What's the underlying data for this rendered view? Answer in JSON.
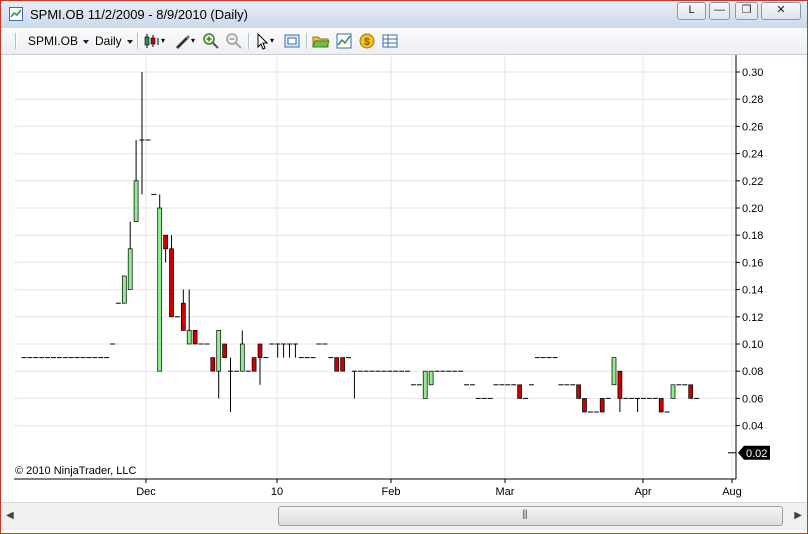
{
  "window": {
    "title": "SPMI.OB  11/2/2009 - 8/9/2010 (Daily)",
    "buttons": {
      "l": "L",
      "minimize": "—",
      "restore": "❐",
      "close": "✕"
    }
  },
  "toolbar": {
    "instrument": "SPMI.OB",
    "interval": "Daily",
    "icons": [
      "candlestick-style-icon",
      "drawing-tool-icon",
      "zoom-in-icon",
      "zoom-out-icon",
      "pointer-icon",
      "snapshot-icon",
      "open-folder-icon",
      "chart-properties-icon",
      "money-icon",
      "data-box-icon"
    ]
  },
  "copyright": "© 2010 NinjaTrader, LLC",
  "colors": {
    "up": "#90ee90",
    "down": "#cc0000",
    "wick": "#000000",
    "grid": "#e6e6e6"
  },
  "chart_data": {
    "type": "candlestick",
    "x_labels": [
      "Dec",
      "10",
      "Feb",
      "Mar",
      "Apr",
      "Aug"
    ],
    "y_ticks": [
      "0.30",
      "0.28",
      "0.26",
      "0.24",
      "0.22",
      "0.20",
      "0.18",
      "0.16",
      "0.14",
      "0.12",
      "0.10",
      "0.08",
      "0.06",
      "0.04"
    ],
    "ylim": [
      0.02,
      0.3
    ],
    "last_price": "0.02",
    "grid": true,
    "candles": [
      {
        "o": 0.09,
        "h": 0.09,
        "l": 0.09,
        "c": 0.09,
        "n": 15
      },
      {
        "o": 0.1,
        "h": 0.1,
        "l": 0.1,
        "c": 0.1
      },
      {
        "o": 0.13,
        "h": 0.13,
        "l": 0.13,
        "c": 0.13
      },
      {
        "o": 0.13,
        "h": 0.15,
        "l": 0.13,
        "c": 0.15
      },
      {
        "o": 0.14,
        "h": 0.19,
        "l": 0.14,
        "c": 0.17
      },
      {
        "o": 0.19,
        "h": 0.25,
        "l": 0.19,
        "c": 0.22
      },
      {
        "o": 0.25,
        "h": 0.3,
        "l": 0.21,
        "c": 0.25
      },
      {
        "o": 0.25,
        "h": 0.25,
        "l": 0.25,
        "c": 0.25
      },
      {
        "o": 0.21,
        "h": 0.21,
        "l": 0.21,
        "c": 0.21
      },
      {
        "o": 0.08,
        "h": 0.21,
        "l": 0.08,
        "c": 0.2
      },
      {
        "o": 0.18,
        "h": 0.18,
        "l": 0.16,
        "c": 0.17
      },
      {
        "o": 0.17,
        "h": 0.18,
        "l": 0.12,
        "c": 0.12
      },
      {
        "o": 0.12,
        "h": 0.12,
        "l": 0.12,
        "c": 0.12
      },
      {
        "o": 0.13,
        "h": 0.14,
        "l": 0.11,
        "c": 0.11
      },
      {
        "o": 0.1,
        "h": 0.14,
        "l": 0.1,
        "c": 0.11
      },
      {
        "o": 0.11,
        "h": 0.11,
        "l": 0.1,
        "c": 0.1
      },
      {
        "o": 0.1,
        "h": 0.1,
        "l": 0.1,
        "c": 0.1
      },
      {
        "o": 0.1,
        "h": 0.1,
        "l": 0.1,
        "c": 0.1
      },
      {
        "o": 0.09,
        "h": 0.09,
        "l": 0.08,
        "c": 0.08
      },
      {
        "o": 0.08,
        "h": 0.11,
        "l": 0.06,
        "c": 0.11
      },
      {
        "o": 0.1,
        "h": 0.1,
        "l": 0.09,
        "c": 0.09
      },
      {
        "o": 0.08,
        "h": 0.09,
        "l": 0.05,
        "c": 0.08
      },
      {
        "o": 0.08,
        "h": 0.08,
        "l": 0.08,
        "c": 0.08
      },
      {
        "o": 0.08,
        "h": 0.11,
        "l": 0.08,
        "c": 0.1
      },
      {
        "o": 0.08,
        "h": 0.08,
        "l": 0.08,
        "c": 0.08
      },
      {
        "o": 0.09,
        "h": 0.09,
        "l": 0.08,
        "c": 0.08
      },
      {
        "o": 0.1,
        "h": 0.1,
        "l": 0.07,
        "c": 0.09
      },
      {
        "o": 0.09,
        "h": 0.09,
        "l": 0.09,
        "c": 0.09
      },
      {
        "o": 0.1,
        "h": 0.1,
        "l": 0.1,
        "c": 0.1
      },
      {
        "o": 0.1,
        "h": 0.1,
        "l": 0.09,
        "c": 0.1,
        "n": 4
      },
      {
        "o": 0.09,
        "h": 0.09,
        "l": 0.09,
        "c": 0.09,
        "n": 3
      },
      {
        "o": 0.1,
        "h": 0.1,
        "l": 0.1,
        "c": 0.1,
        "n": 2
      },
      {
        "o": 0.09,
        "h": 0.09,
        "l": 0.09,
        "c": 0.09
      },
      {
        "o": 0.09,
        "h": 0.09,
        "l": 0.08,
        "c": 0.08
      },
      {
        "o": 0.09,
        "h": 0.09,
        "l": 0.08,
        "c": 0.08
      },
      {
        "o": 0.09,
        "h": 0.09,
        "l": 0.09,
        "c": 0.09
      },
      {
        "o": 0.08,
        "h": 0.08,
        "l": 0.06,
        "c": 0.08
      },
      {
        "o": 0.08,
        "h": 0.08,
        "l": 0.08,
        "c": 0.08,
        "n": 9
      },
      {
        "o": 0.07,
        "h": 0.07,
        "l": 0.07,
        "c": 0.07,
        "n": 2
      },
      {
        "o": 0.06,
        "h": 0.08,
        "l": 0.06,
        "c": 0.08
      },
      {
        "o": 0.07,
        "h": 0.08,
        "l": 0.07,
        "c": 0.08
      },
      {
        "o": 0.08,
        "h": 0.08,
        "l": 0.08,
        "c": 0.08,
        "n": 5
      },
      {
        "o": 0.07,
        "h": 0.07,
        "l": 0.07,
        "c": 0.07,
        "n": 2
      },
      {
        "o": 0.06,
        "h": 0.06,
        "l": 0.06,
        "c": 0.06,
        "n": 3
      },
      {
        "o": 0.07,
        "h": 0.07,
        "l": 0.07,
        "c": 0.07,
        "n": 4
      },
      {
        "o": 0.07,
        "h": 0.07,
        "l": 0.06,
        "c": 0.06
      },
      {
        "o": 0.06,
        "h": 0.06,
        "l": 0.06,
        "c": 0.06
      },
      {
        "o": 0.07,
        "h": 0.07,
        "l": 0.07,
        "c": 0.07
      },
      {
        "o": 0.09,
        "h": 0.09,
        "l": 0.09,
        "c": 0.09,
        "n": 4
      },
      {
        "o": 0.07,
        "h": 0.07,
        "l": 0.07,
        "c": 0.07,
        "n": 3
      },
      {
        "o": 0.07,
        "h": 0.07,
        "l": 0.06,
        "c": 0.06
      },
      {
        "o": 0.06,
        "h": 0.06,
        "l": 0.05,
        "c": 0.05
      },
      {
        "o": 0.05,
        "h": 0.05,
        "l": 0.05,
        "c": 0.05,
        "n": 2
      },
      {
        "o": 0.06,
        "h": 0.06,
        "l": 0.05,
        "c": 0.05
      },
      {
        "o": 0.06,
        "h": 0.06,
        "l": 0.06,
        "c": 0.06
      },
      {
        "o": 0.07,
        "h": 0.09,
        "l": 0.07,
        "c": 0.09
      },
      {
        "o": 0.08,
        "h": 0.08,
        "l": 0.05,
        "c": 0.06
      },
      {
        "o": 0.06,
        "h": 0.06,
        "l": 0.06,
        "c": 0.06,
        "n": 2
      },
      {
        "o": 0.06,
        "h": 0.06,
        "l": 0.05,
        "c": 0.06
      },
      {
        "o": 0.06,
        "h": 0.06,
        "l": 0.06,
        "c": 0.06,
        "n": 3
      },
      {
        "o": 0.06,
        "h": 0.06,
        "l": 0.05,
        "c": 0.05
      },
      {
        "o": 0.05,
        "h": 0.05,
        "l": 0.05,
        "c": 0.05
      },
      {
        "o": 0.06,
        "h": 0.07,
        "l": 0.06,
        "c": 0.07
      },
      {
        "o": 0.07,
        "h": 0.07,
        "l": 0.07,
        "c": 0.07
      },
      {
        "o": 0.07,
        "h": 0.07,
        "l": 0.07,
        "c": 0.07
      },
      {
        "o": 0.07,
        "h": 0.07,
        "l": 0.06,
        "c": 0.06
      },
      {
        "o": 0.06,
        "h": 0.06,
        "l": 0.06,
        "c": 0.06
      }
    ]
  }
}
